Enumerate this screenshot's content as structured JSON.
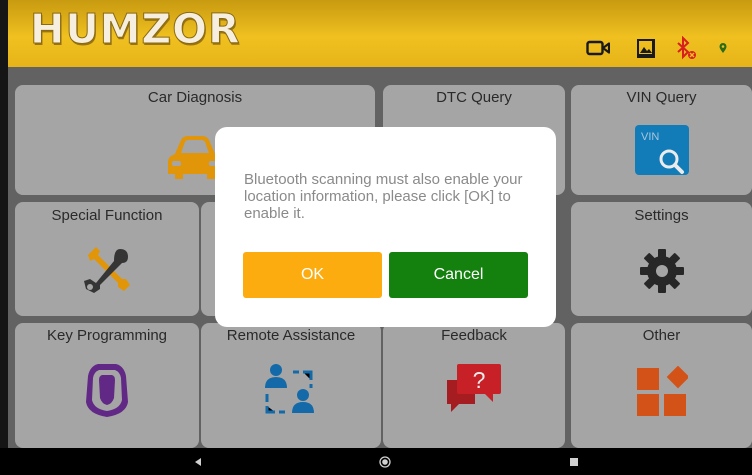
{
  "header": {
    "logo_text": "HUMZOR"
  },
  "status_icons": [
    "video-camera-icon",
    "image-icon",
    "bluetooth-off-icon",
    "location-icon"
  ],
  "tiles": [
    {
      "label": "Car Diagnosis",
      "icon": "car-icon"
    },
    {
      "label": "DTC Query",
      "icon": "dtc-icon"
    },
    {
      "label": "VIN Query",
      "icon": "vin-search-icon",
      "icon_text": "VIN"
    },
    {
      "label": "Special Function",
      "icon": "tools-icon"
    },
    {
      "label": "Settings",
      "icon": "gear-icon"
    },
    {
      "label": "Key Programming",
      "icon": "car-key-icon"
    },
    {
      "label": "Remote Assistance",
      "icon": "remote-users-icon"
    },
    {
      "label": "Feedback",
      "icon": "feedback-question-icon",
      "icon_text": "?"
    },
    {
      "label": "Other",
      "icon": "other-apps-icon"
    }
  ],
  "dialog": {
    "message": "Bluetooth scanning must also enable your location information, please click [OK] to enable it.",
    "ok_label": "OK",
    "cancel_label": "Cancel"
  },
  "colors": {
    "ok": "#fcac0f",
    "cancel": "#14800e",
    "header": "#f0c020",
    "tile": "#b4b4b4"
  },
  "navbar": [
    "back-icon",
    "home-icon",
    "recents-icon"
  ]
}
